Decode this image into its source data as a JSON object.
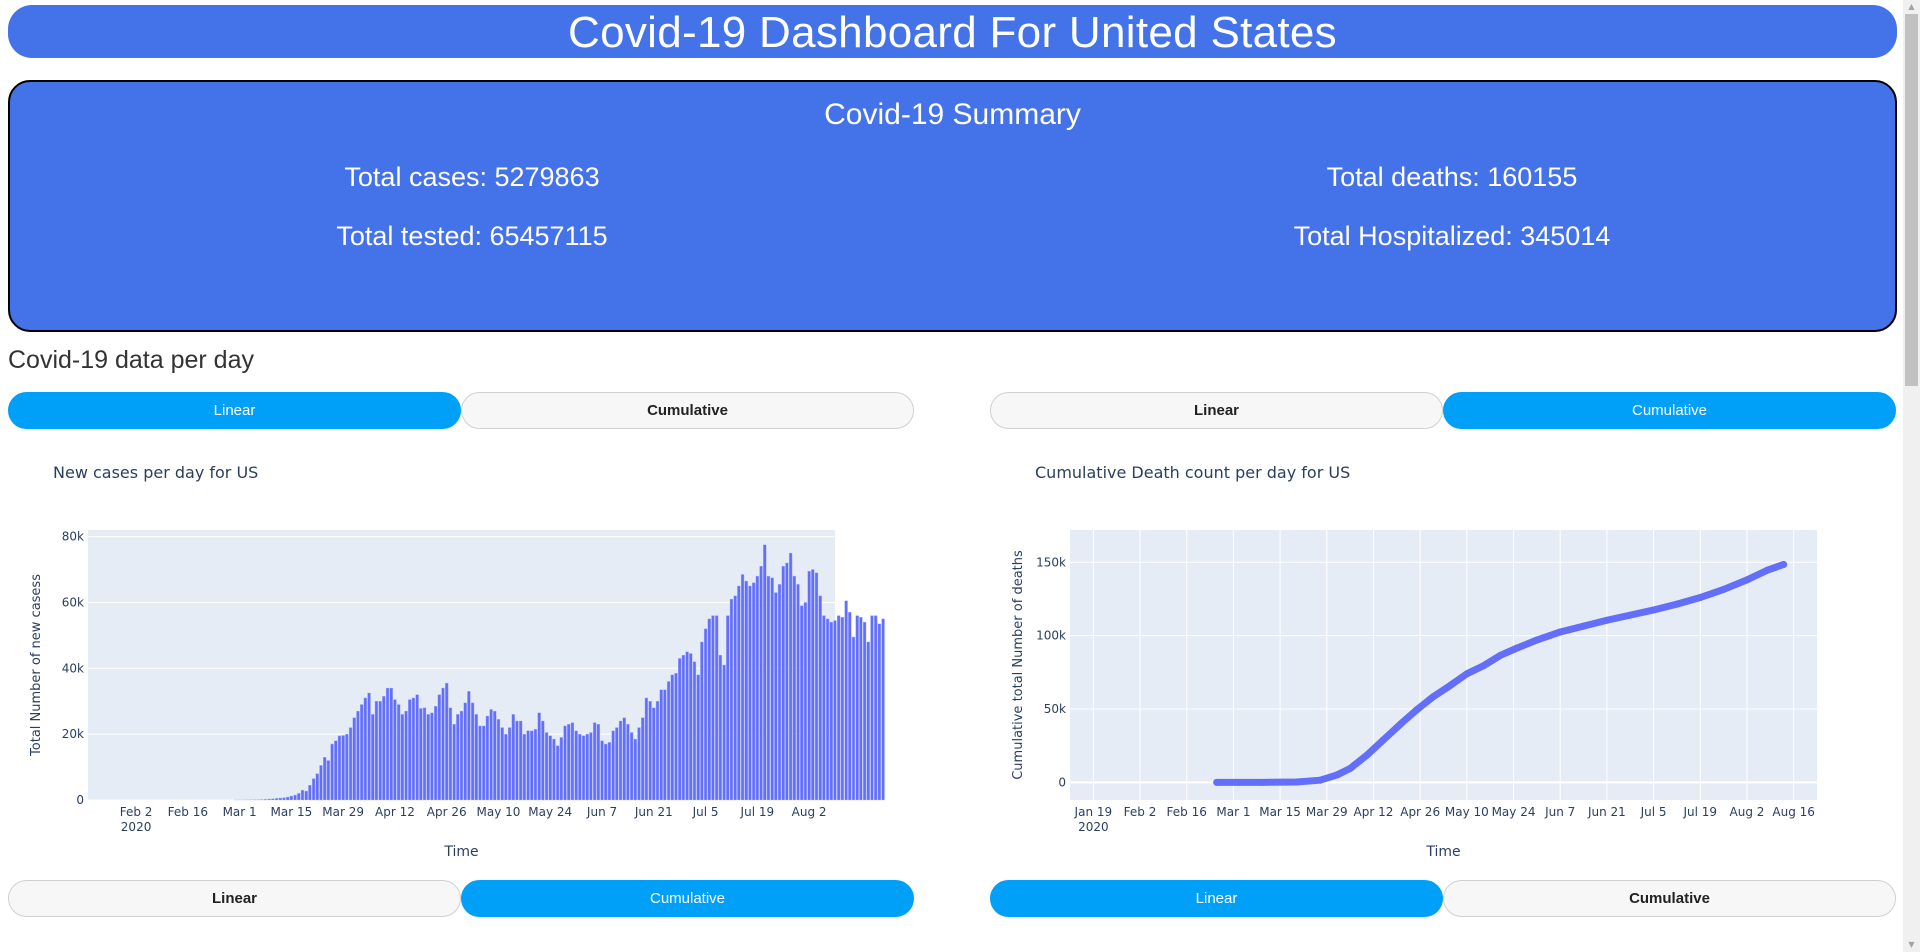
{
  "header": {
    "title": "Covid-19 Dashboard For United States"
  },
  "summary": {
    "title": "Covid-19 Summary",
    "total_cases": "Total cases: 5279863",
    "total_tested": "Total tested: 65457115",
    "total_deaths": "Total deaths: 160155",
    "total_hospitalized": "Total Hospitalized: 345014"
  },
  "section": {
    "title": "Covid-19 data per day"
  },
  "toggles": {
    "left_top": {
      "linear": "Linear",
      "cumulative": "Cumulative",
      "active": "linear"
    },
    "right_top": {
      "linear": "Linear",
      "cumulative": "Cumulative",
      "active": "cumulative"
    },
    "left_bottom": {
      "linear": "Linear",
      "cumulative": "Cumulative",
      "active": "cumulative"
    },
    "right_bottom": {
      "linear": "Linear",
      "cumulative": "Cumulative",
      "active": "linear"
    }
  },
  "colors": {
    "header_bg": "#4472e9",
    "button_active": "#00a0f8",
    "button_inactive": "#f7f7f7",
    "plot_bg": "#e5ecf6",
    "series": "#636efa"
  },
  "chart_data": [
    {
      "type": "bar",
      "title": "New cases per day for US",
      "xlabel": "Time",
      "ylabel": "Total Number of new casess",
      "x_start": "2020-01-22",
      "x_range": [
        "2020-01-20",
        "2020-08-09"
      ],
      "x_ticks": [
        "Feb 2",
        "Feb 16",
        "Mar 1",
        "Mar 15",
        "Mar 29",
        "Apr 12",
        "Apr 26",
        "May 10",
        "May 24",
        "Jun 7",
        "Jun 21",
        "Jul 5",
        "Jul 19",
        "Aug 2"
      ],
      "x_tick_sub": "2020",
      "ylim": [
        0,
        82000
      ],
      "y_ticks": [
        0,
        20000,
        40000,
        60000,
        80000
      ],
      "y_tick_labels": [
        "0",
        "20k",
        "40k",
        "60k",
        "80k"
      ],
      "grid": true,
      "values": [
        0,
        0,
        0,
        0,
        0,
        0,
        0,
        0,
        0,
        0,
        0,
        0,
        0,
        0,
        0,
        0,
        0,
        0,
        0,
        0,
        0,
        0,
        0,
        0,
        0,
        0,
        0,
        0,
        0,
        0,
        0,
        0,
        0,
        0,
        0,
        0,
        0,
        0,
        10,
        20,
        30,
        50,
        60,
        80,
        100,
        150,
        200,
        300,
        400,
        500,
        600,
        700,
        900,
        1200,
        1500,
        2000,
        3000,
        2700,
        4500,
        6500,
        8000,
        10500,
        13000,
        12000,
        17000,
        18000,
        19500,
        19600,
        20000,
        22000,
        25000,
        27000,
        29000,
        31000,
        32500,
        26000,
        30000,
        30000,
        31500,
        34000,
        34000,
        30500,
        29000,
        26000,
        27000,
        30500,
        31000,
        32000,
        27800,
        28000,
        26000,
        26500,
        28500,
        32000,
        34000,
        35500,
        28000,
        23000,
        26000,
        27000,
        29500,
        33000,
        29500,
        26000,
        22500,
        22500,
        25500,
        27500,
        27000,
        24500,
        22000,
        20000,
        22000,
        26000,
        24000,
        24000,
        20000,
        21000,
        21000,
        21500,
        26500,
        24000,
        20500,
        19500,
        18500,
        16500,
        19000,
        22500,
        23000,
        23500,
        21000,
        20000,
        19500,
        20000,
        20500,
        23500,
        23000,
        18000,
        17000,
        17500,
        21000,
        22000,
        24000,
        25000,
        23000,
        20500,
        18500,
        22000,
        25000,
        31000,
        30000,
        28000,
        30000,
        33500,
        33500,
        36000,
        38000,
        38500,
        43000,
        44000,
        45000,
        44500,
        42000,
        38000,
        48000,
        52000,
        55000,
        56000,
        56000,
        44000,
        41000,
        56000,
        61000,
        62000,
        65000,
        68500,
        66500,
        65000,
        66000,
        68000,
        71000,
        77500,
        68000,
        67500,
        63000,
        65500,
        71000,
        72000,
        75000,
        68000,
        65500,
        59000,
        60000,
        69500,
        70000,
        69000,
        62000,
        56000,
        55000,
        54000,
        54500,
        56000,
        55500,
        60500,
        57000,
        49500,
        56000,
        55500,
        54000,
        48000,
        56000,
        56000,
        53500,
        55000
      ]
    },
    {
      "type": "line",
      "title": "Cumulative Death count per day for US",
      "xlabel": "Time",
      "ylabel": "Cumulative total Number of deaths",
      "x_range": [
        "2020-01-12",
        "2020-08-23"
      ],
      "x_ticks": [
        "Jan 19",
        "Feb 2",
        "Feb 16",
        "Mar 1",
        "Mar 15",
        "Mar 29",
        "Apr 12",
        "Apr 26",
        "May 10",
        "May 24",
        "Jun 7",
        "Jun 21",
        "Jul 5",
        "Jul 19",
        "Aug 2",
        "Aug 16"
      ],
      "x_tick_sub": "2020",
      "ylim": [
        -12000,
        172000
      ],
      "y_ticks": [
        0,
        50000,
        100000,
        150000
      ],
      "y_tick_labels": [
        "0",
        "50k",
        "100k",
        "150k"
      ],
      "grid": true,
      "points": [
        [
          "2020-02-25",
          0
        ],
        [
          "2020-03-10",
          30
        ],
        [
          "2020-03-20",
          250
        ],
        [
          "2020-03-27",
          1500
        ],
        [
          "2020-04-01",
          5000
        ],
        [
          "2020-04-05",
          9500
        ],
        [
          "2020-04-10",
          18500
        ],
        [
          "2020-04-15",
          29000
        ],
        [
          "2020-04-20",
          39500
        ],
        [
          "2020-04-25",
          49500
        ],
        [
          "2020-04-30",
          58500
        ],
        [
          "2020-05-05",
          66000
        ],
        [
          "2020-05-10",
          74000
        ],
        [
          "2020-05-15",
          79500
        ],
        [
          "2020-05-20",
          86500
        ],
        [
          "2020-05-25",
          91500
        ],
        [
          "2020-05-31",
          97000
        ],
        [
          "2020-06-07",
          102500
        ],
        [
          "2020-06-14",
          106500
        ],
        [
          "2020-06-21",
          110500
        ],
        [
          "2020-06-28",
          114000
        ],
        [
          "2020-07-05",
          117500
        ],
        [
          "2020-07-12",
          121500
        ],
        [
          "2020-07-19",
          126000
        ],
        [
          "2020-07-26",
          131500
        ],
        [
          "2020-08-02",
          138000
        ],
        [
          "2020-08-08",
          144500
        ],
        [
          "2020-08-13",
          148500
        ]
      ]
    }
  ]
}
